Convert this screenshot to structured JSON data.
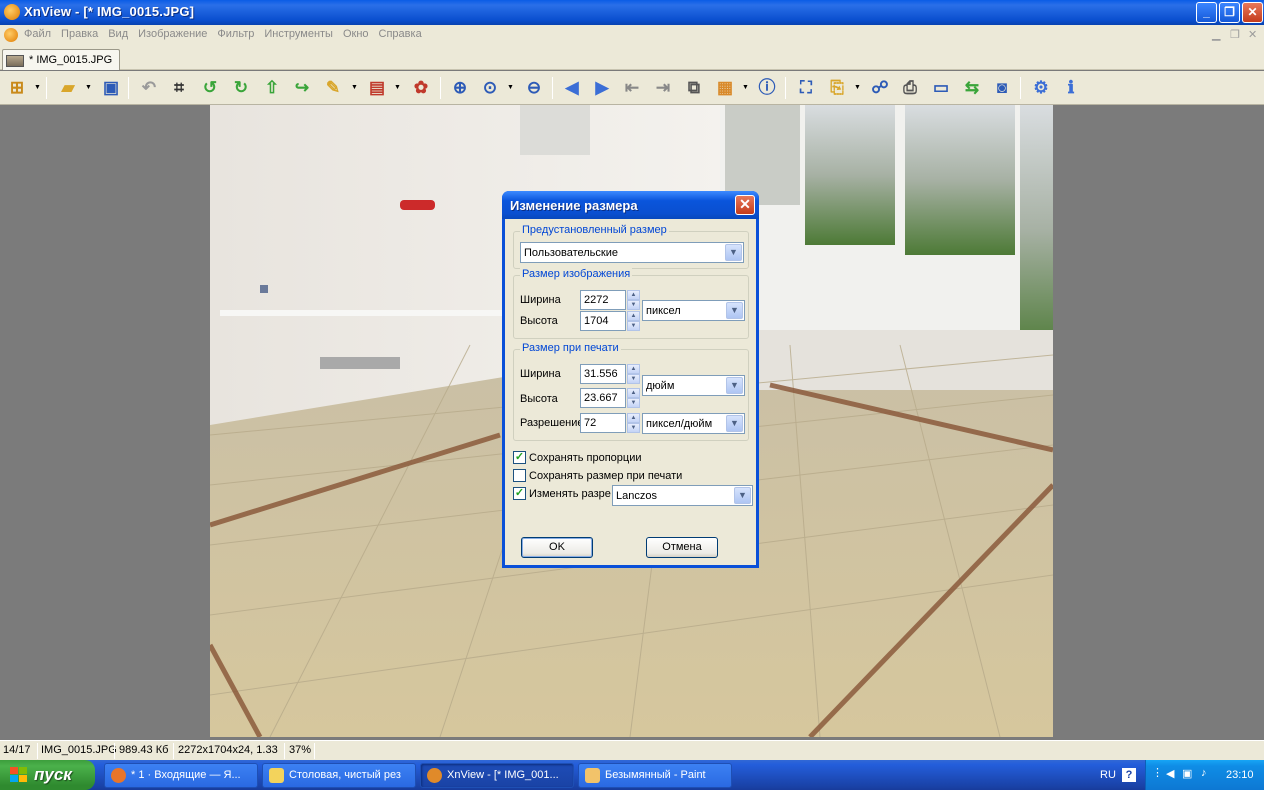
{
  "window": {
    "title": "XnView - [* IMG_0015.JPG]",
    "buttons": {
      "minimize": "_",
      "restore": "❐",
      "close": "✕"
    }
  },
  "menu": {
    "items": [
      "Файл",
      "Правка",
      "Вид",
      "Изображение",
      "Фильтр",
      "Инструменты",
      "Окно",
      "Справка"
    ]
  },
  "tab": {
    "label": "* IMG_0015.JPG"
  },
  "toolbar": {
    "icons": [
      "browser-icon",
      "open-icon",
      "save-icon",
      "undo-icon",
      "crop-icon",
      "rotate-left-icon",
      "rotate-right-icon",
      "flip-icon",
      "rotate-icon",
      "adjust-icon",
      "color-icon",
      "effects-icon",
      "zoom-in-icon",
      "zoom-icon",
      "zoom-out-icon",
      "prev-icon",
      "next-icon",
      "first-icon",
      "last-icon",
      "fullscreen-icon",
      "slideshow-icon",
      "properties-icon",
      "fit-icon",
      "export-icon",
      "find-icon",
      "print-icon",
      "scan-icon",
      "convert-icon",
      "capture-icon",
      "settings-icon",
      "about-icon"
    ]
  },
  "dialog": {
    "title": "Изменение размера",
    "close": "✕",
    "preset": {
      "legend": "Предустановленный размер",
      "value": "Пользовательские"
    },
    "image_size": {
      "legend": "Размер изображения",
      "width_label": "Ширина",
      "width_value": "2272",
      "height_label": "Высота",
      "height_value": "1704",
      "unit": "пиксел"
    },
    "print_size": {
      "legend": "Размер при печати",
      "width_label": "Ширина",
      "width_value": "31.556",
      "height_label": "Высота",
      "height_value": "23.667",
      "unit": "дюйм",
      "resolution_label": "Разрешение",
      "resolution_value": "72",
      "resolution_unit": "пиксел/дюйм"
    },
    "keep_ratio": {
      "label": "Сохранять пропорции",
      "checked": true
    },
    "keep_print_size": {
      "label": "Сохранять размер при печати",
      "checked": false
    },
    "resample": {
      "label": "Изменять разре",
      "checked": true,
      "method": "Lanczos"
    },
    "ok": "OK",
    "cancel": "Отмена"
  },
  "statusbar": {
    "position": "14/17",
    "filename": "IMG_0015.JPG",
    "filesize": "989.43 Кб",
    "dimensions": "2272x1704x24, 1.33",
    "zoom": "37%"
  },
  "taskbar": {
    "start": "пуск",
    "tasks": [
      {
        "label": "* 1 · Входящие — Я...",
        "icon_color": "#e8752a",
        "active": false
      },
      {
        "label": "Столовая, чистый рез",
        "icon_color": "#f3d35c",
        "active": false
      },
      {
        "label": "XnView - [* IMG_001...",
        "icon_color": "#e08a2a",
        "active": true
      },
      {
        "label": "Безымянный - Paint",
        "icon_color": "#f2c36a",
        "active": false
      }
    ],
    "lang": "RU",
    "clock": "23:10"
  },
  "colors": {
    "title_blue": "#0a50d8",
    "face": "#ece9d8",
    "legend_blue": "#0046d5",
    "start_green": "#3c9e3c"
  }
}
